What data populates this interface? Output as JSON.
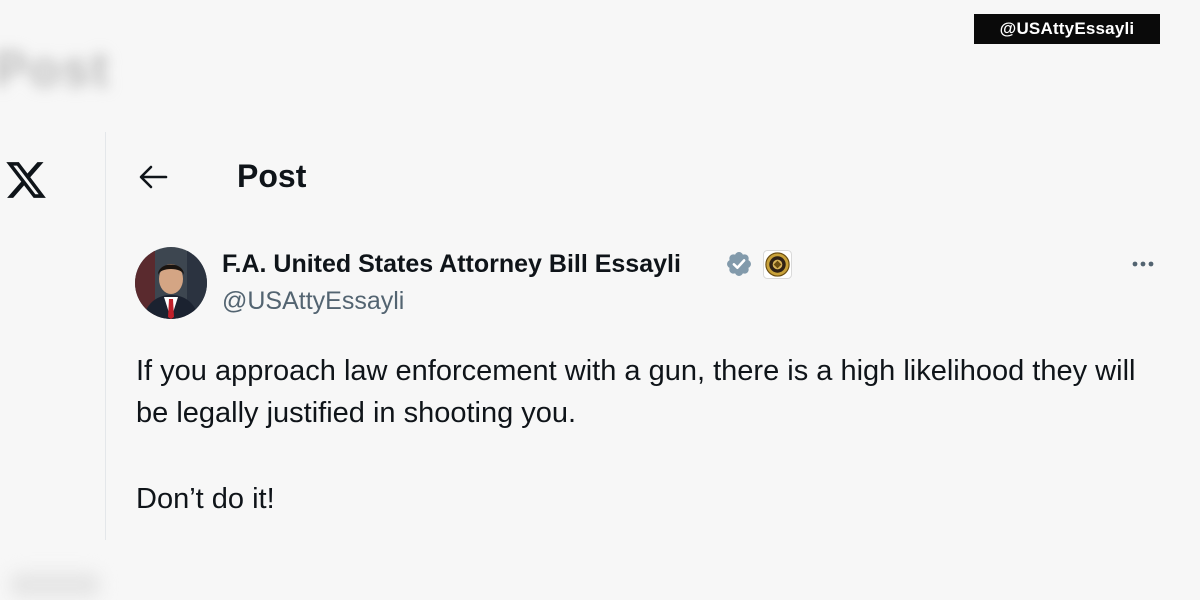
{
  "overlay": {
    "handle_badge": "@USAttyEssayli"
  },
  "background": {
    "blurred_heading": "Post"
  },
  "sidebar": {
    "logo_icon": "x-logo-icon"
  },
  "header": {
    "back_icon": "arrow-left-icon",
    "title": "Post"
  },
  "post": {
    "author_name": "F.A. United States Attorney Bill Essayli",
    "verified_icon": "verified-badge-icon",
    "affiliate_icon": "doj-seal-icon",
    "handle": "@USAttyEssayli",
    "more_icon": "more-horizontal-icon",
    "paragraphs": [
      "If you approach law enforcement with a gun, there is a high likelihood they will be legally justified in shooting you.",
      "Don’t do it!"
    ]
  },
  "colors": {
    "text_primary": "#0f1419",
    "text_secondary": "#536471",
    "verified": "#829aab",
    "badge_bg": "#0a0a0a"
  }
}
